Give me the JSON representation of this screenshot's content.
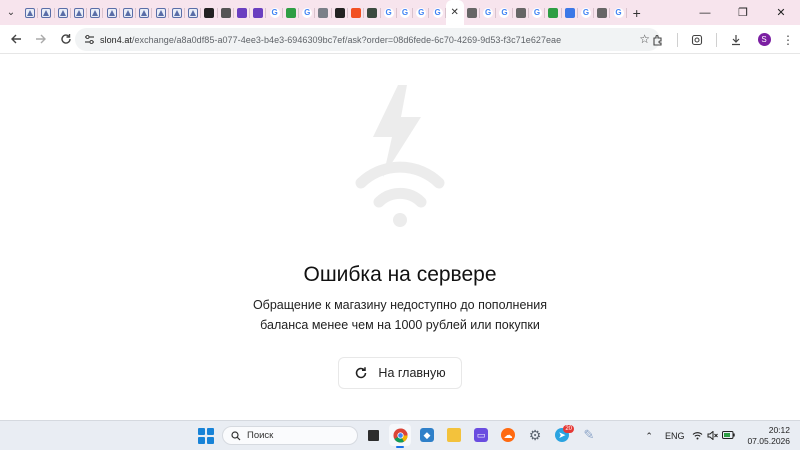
{
  "browser": {
    "tabs": [
      {
        "icon": "ad-icon",
        "glyph": "Ад",
        "color": "#5a6ea8"
      },
      {
        "icon": "ad-icon",
        "glyph": "Ад",
        "color": "#5a6ea8"
      },
      {
        "icon": "ad-icon",
        "glyph": "Ад",
        "color": "#5a6ea8"
      },
      {
        "icon": "ad-icon",
        "glyph": "Ад",
        "color": "#5a6ea8"
      },
      {
        "icon": "ad-icon",
        "glyph": "Ад",
        "color": "#5a6ea8"
      },
      {
        "icon": "ad-icon",
        "glyph": "Ад",
        "color": "#5a6ea8"
      },
      {
        "icon": "ad-icon",
        "glyph": "Ад",
        "color": "#5a6ea8"
      },
      {
        "icon": "ad-icon",
        "glyph": "Ад",
        "color": "#5a6ea8"
      },
      {
        "icon": "ad-icon",
        "glyph": "Ад",
        "color": "#5a6ea8"
      },
      {
        "icon": "ad-icon",
        "glyph": "Ад",
        "color": "#5a6ea8"
      },
      {
        "icon": "ad-icon",
        "glyph": "Ад",
        "color": "#5a6ea8"
      },
      {
        "icon": "github-icon",
        "glyph": "●",
        "color": "#222222"
      },
      {
        "icon": "circle-icon",
        "glyph": "◎",
        "color": "#555555"
      },
      {
        "icon": "purple-app-icon",
        "glyph": "◈",
        "color": "#6a3fc0"
      },
      {
        "icon": "purple-app-icon",
        "glyph": "◈",
        "color": "#6a3fc0"
      },
      {
        "icon": "google-icon",
        "glyph": "G",
        "color": "#4285f4"
      },
      {
        "icon": "green-x-icon",
        "glyph": "x",
        "color": "#2e9e44"
      },
      {
        "icon": "google-icon",
        "glyph": "G",
        "color": "#4285f4"
      },
      {
        "icon": "grey-app-icon",
        "glyph": "◐",
        "color": "#7a7f88"
      },
      {
        "icon": "github-icon",
        "glyph": "●",
        "color": "#222222"
      },
      {
        "icon": "microsoft-icon",
        "glyph": "▦",
        "color": "#f25022"
      },
      {
        "icon": "dark-app-icon",
        "glyph": "▣",
        "color": "#3b4a3f"
      },
      {
        "icon": "google-icon",
        "glyph": "G",
        "color": "#4285f4"
      },
      {
        "icon": "google-icon",
        "glyph": "G",
        "color": "#4285f4"
      },
      {
        "icon": "google-icon",
        "glyph": "G",
        "color": "#4285f4"
      },
      {
        "icon": "google-icon",
        "glyph": "G",
        "color": "#4285f4"
      }
    ],
    "tabs_after": [
      {
        "icon": "globe-icon",
        "glyph": "◍",
        "color": "#666666"
      },
      {
        "icon": "google-icon",
        "glyph": "G",
        "color": "#4285f4"
      },
      {
        "icon": "google-icon",
        "glyph": "G",
        "color": "#4285f4"
      },
      {
        "icon": "globe-icon",
        "glyph": "◍",
        "color": "#666666"
      },
      {
        "icon": "google-icon",
        "glyph": "G",
        "color": "#4285f4"
      },
      {
        "icon": "green-app-icon",
        "glyph": "✿",
        "color": "#2e9e44"
      },
      {
        "icon": "multicolor-app-icon",
        "glyph": "✿",
        "color": "#3b78e7"
      },
      {
        "icon": "google-icon",
        "glyph": "G",
        "color": "#4285f4"
      },
      {
        "icon": "globe-icon",
        "glyph": "◍",
        "color": "#666666"
      },
      {
        "icon": "google-icon",
        "glyph": "G",
        "color": "#4285f4"
      }
    ],
    "active_tab_close": "✕",
    "new_tab": "+",
    "url_host": "slon4.at",
    "url_path": "/exchange/a8a0df85-a077-4ee3-b4e3-6946309bc7ef/ask?order=08d6fede-6c70-4269-9d53-f3c71e627eae",
    "profile_initial": "S"
  },
  "page": {
    "title": "Ошибка на сервере",
    "message": "Обращение к магазину недоступно до пополнения баланса менее чем на 1000 рублей или покупки",
    "home_button": "На главную"
  },
  "taskbar": {
    "search_placeholder": "Поиск",
    "language": "ENG",
    "time": "20:12",
    "date": "07.05.2026",
    "telegram_badge": "20"
  },
  "colors": {
    "tabstrip": "#f7e4ed",
    "illustration": "#ececec",
    "accent": "#1a73e8"
  }
}
